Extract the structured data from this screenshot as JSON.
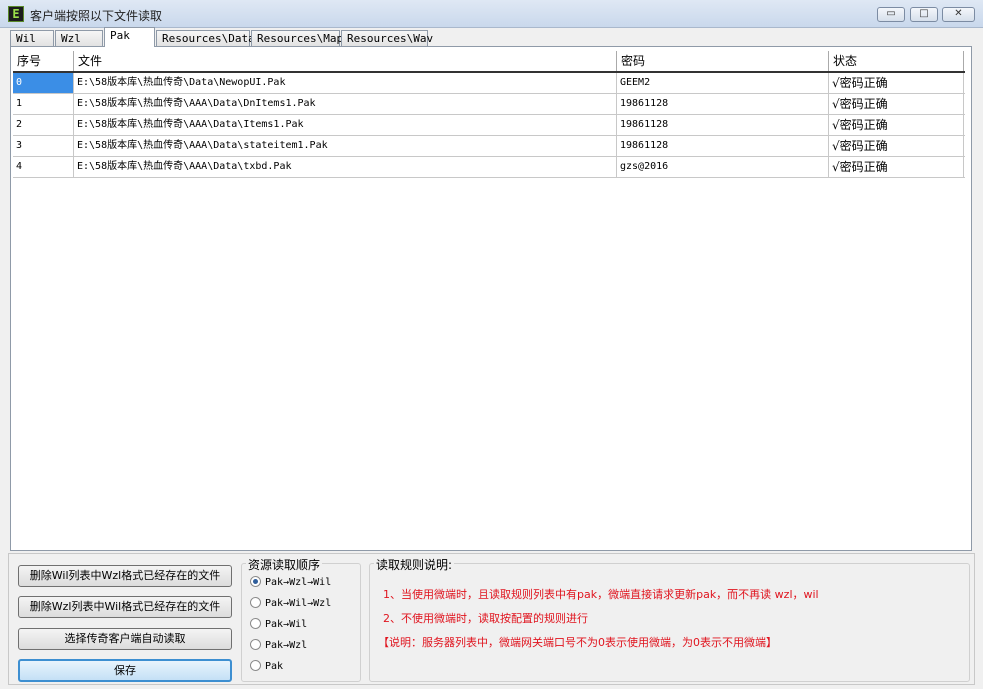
{
  "window": {
    "title": "客户端按照以下文件读取",
    "app_icon_glyph": "E",
    "min_glyph": "▭",
    "max_glyph": "□",
    "close_glyph": "✕"
  },
  "tabs": [
    {
      "label": "Wil",
      "active": false
    },
    {
      "label": "Wzl",
      "active": false
    },
    {
      "label": "Pak",
      "active": true
    },
    {
      "label": "Resources\\Data",
      "active": false
    },
    {
      "label": "Resources\\Map",
      "active": false
    },
    {
      "label": "Resources\\Wav",
      "active": false
    }
  ],
  "table": {
    "columns": [
      "序号",
      "文件",
      "密码",
      "状态"
    ],
    "rows": [
      {
        "idx": "0",
        "file": "E:\\58版本库\\热血传奇\\Data\\NewopUI.Pak",
        "password": "GEEM2",
        "status": "√密码正确"
      },
      {
        "idx": "1",
        "file": "E:\\58版本库\\热血传奇\\AAA\\Data\\DnItems1.Pak",
        "password": "19861128",
        "status": "√密码正确"
      },
      {
        "idx": "2",
        "file": "E:\\58版本库\\热血传奇\\AAA\\Data\\Items1.Pak",
        "password": "19861128",
        "status": "√密码正确"
      },
      {
        "idx": "3",
        "file": "E:\\58版本库\\热血传奇\\AAA\\Data\\stateitem1.Pak",
        "password": "19861128",
        "status": "√密码正确"
      },
      {
        "idx": "4",
        "file": "E:\\58版本库\\热血传奇\\AAA\\Data\\txbd.Pak",
        "password": "gzs@2016",
        "status": "√密码正确"
      }
    ]
  },
  "buttons": {
    "delete_wil": "删除Wil列表中Wzl格式已经存在的文件",
    "delete_wzl": "删除Wzl列表中Wil格式已经存在的文件",
    "auto_read": "选择传奇客户端自动读取",
    "save": "保存"
  },
  "order_group": {
    "title": "资源读取顺序",
    "options": [
      "Pak→Wzl→Wil",
      "Pak→Wil→Wzl",
      "Pak→Wil",
      "Pak→Wzl",
      "Pak"
    ],
    "selected_index": 0
  },
  "rules_group": {
    "title": "读取规则说明:",
    "lines": [
      "1、当使用微端时，且读取规则列表中有pak，微端直接请求更新pak，而不再读 wzl，wil",
      "2、不使用微端时，读取按配置的规则进行",
      "【说明：服务器列表中，微端网关端口号不为0表示使用微端，为0表示不用微端】"
    ],
    "text_color": "#e0141e"
  },
  "colors": {
    "selection": "#3b8ee6",
    "primary_button_border": "#3d8fd1"
  }
}
